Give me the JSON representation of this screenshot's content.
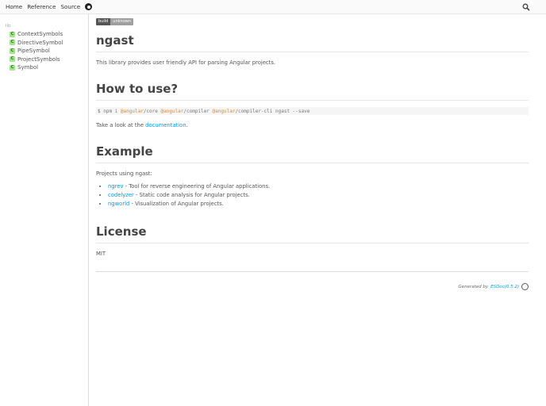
{
  "nav": {
    "home": "Home",
    "reference": "Reference",
    "source": "Source"
  },
  "sidebar": {
    "dir": "lib",
    "items": [
      {
        "kind": "C",
        "label": "ContextSymbols"
      },
      {
        "kind": "C",
        "label": "DirectiveSymbol"
      },
      {
        "kind": "C",
        "label": "PipeSymbol"
      },
      {
        "kind": "C",
        "label": "ProjectSymbols"
      },
      {
        "kind": "C",
        "label": "Symbol"
      }
    ]
  },
  "badge": {
    "left": "build",
    "right": "unknown"
  },
  "title": "ngast",
  "intro": "This library provides user friendly API for parsing Angular projects.",
  "how": {
    "heading": "How to use?",
    "code": [
      "$ npm i ",
      "@angular",
      "/core ",
      "@angular",
      "/compiler ",
      "@angular",
      "/compiler-cli ngast --save"
    ],
    "take_prefix": "Take a look at the ",
    "take_link": "documentation",
    "take_suffix": "."
  },
  "example": {
    "heading": "Example",
    "intro": "Projects using ngast:",
    "items": [
      {
        "link": "ngrev",
        "text": " - Tool for reverse engineering of Angular applications."
      },
      {
        "link": "codelyzer",
        "text": " - Static code analysis for Angular projects."
      },
      {
        "link": "ngworld",
        "text": " - Visualization of Angular projects."
      }
    ]
  },
  "license": {
    "heading": "License",
    "text": "MIT"
  },
  "footer": {
    "prefix": "Generated by ",
    "link": "ESDoc(0.5.2)"
  }
}
